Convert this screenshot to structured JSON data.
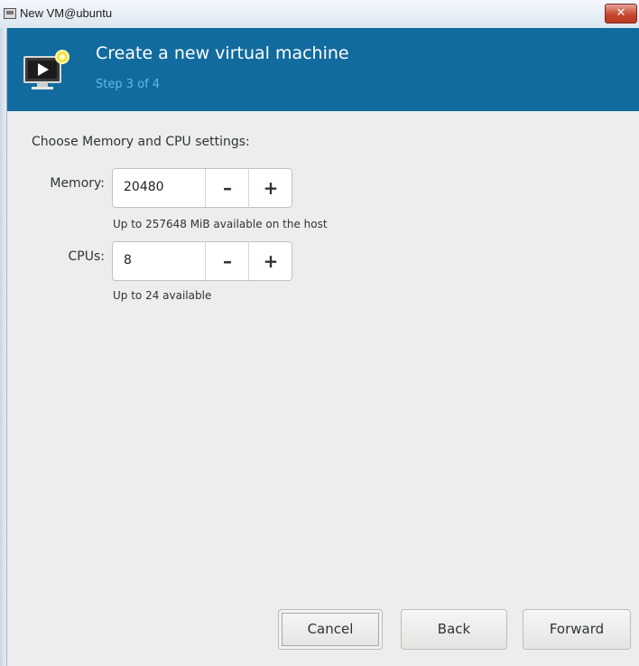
{
  "window": {
    "title": "New VM@ubuntu",
    "close_label": "✕"
  },
  "header": {
    "title": "Create a new virtual machine",
    "step": "Step 3 of 4"
  },
  "content": {
    "section_label": "Choose Memory and CPU settings:",
    "memory": {
      "label": "Memory:",
      "value": "20480",
      "minus_label": "–",
      "plus_label": "+",
      "hint": "Up to 257648 MiB available on the host"
    },
    "cpus": {
      "label": "CPUs:",
      "value": "8",
      "minus_label": "–",
      "plus_label": "+",
      "hint": "Up to 24 available"
    }
  },
  "buttons": {
    "cancel": "Cancel",
    "back": "Back",
    "forward": "Forward"
  },
  "colors": {
    "header_bg": "#126b9e",
    "step_text": "#65b7e8",
    "window_bg": "#ededed"
  }
}
